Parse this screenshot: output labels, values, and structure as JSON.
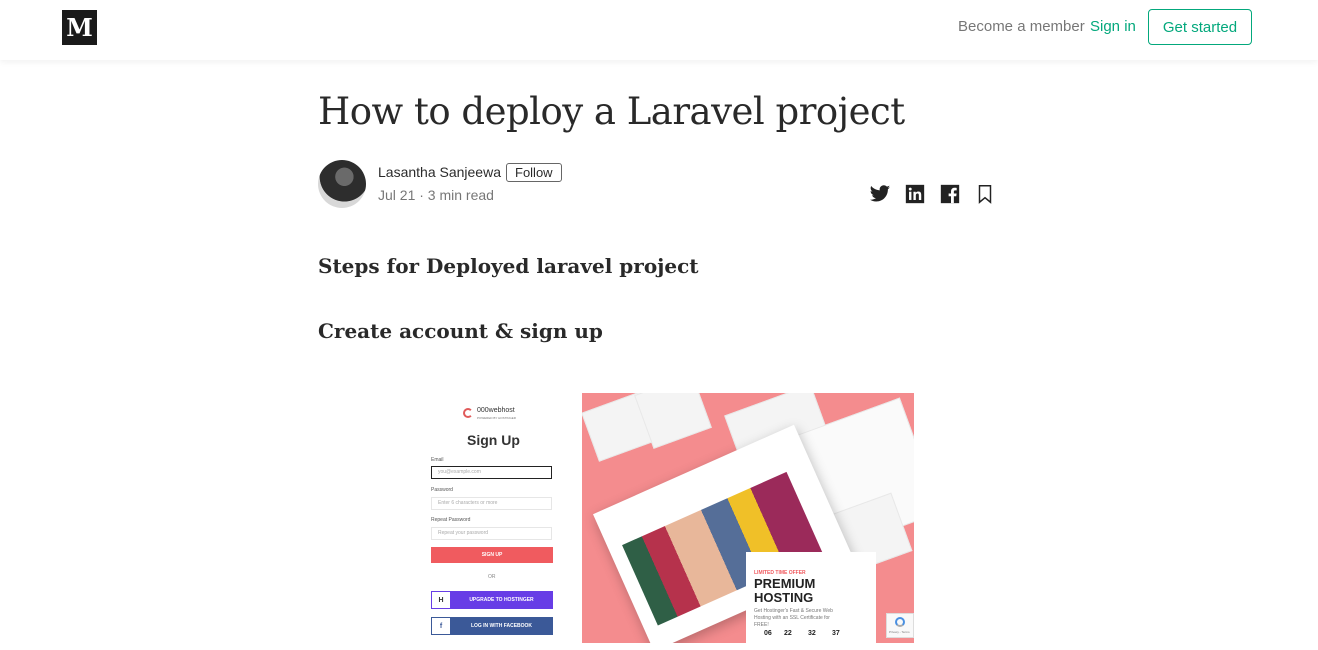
{
  "header": {
    "logo_letter": "M",
    "become_member": "Become a member",
    "sign_in": "Sign in",
    "get_started": "Get started"
  },
  "article": {
    "title": "How to deploy a Laravel project",
    "author": "Lasantha Sanjeewa",
    "follow_label": "Follow",
    "meta": "Jul 21 · 3 min read",
    "share_icons": [
      "twitter-icon",
      "linkedin-icon",
      "facebook-icon",
      "bookmark-icon"
    ],
    "heading_1": "Steps for Deployed laravel project",
    "heading_2": "Create account & sign up"
  },
  "figure": {
    "brand": "000webhost",
    "brand_sub": "POWERED BY HOSTINGER",
    "signup_title": "Sign Up",
    "email_label": "Email",
    "email_placeholder": "you@example.com",
    "password_label": "Password",
    "password_placeholder": "Enter 6 characters or more",
    "repeat_label": "Repeat Password",
    "repeat_placeholder": "Repeat your password",
    "signup_button": "SIGN UP",
    "or": "OR",
    "upgrade_button": "UPGRADE TO HOSTINGER",
    "facebook_button": "LOG IN WITH FACEBOOK",
    "offer_tag": "LIMITED TIME OFFER",
    "offer_line1": "PREMIUM",
    "offer_line2": "HOSTING",
    "offer_text": "Get Hostinger's Fast & Secure Web Hosting with an SSL Certificate for FREE!",
    "timer": [
      "06",
      "22",
      "32",
      "37"
    ],
    "recaptcha_text": "Privacy - Terms"
  },
  "colors": {
    "accent": "#03a87c",
    "signup_red": "#f05b5f",
    "upgrade_purple": "#673de6",
    "facebook_blue": "#3b5998",
    "promo_pink": "#f48c8e"
  }
}
